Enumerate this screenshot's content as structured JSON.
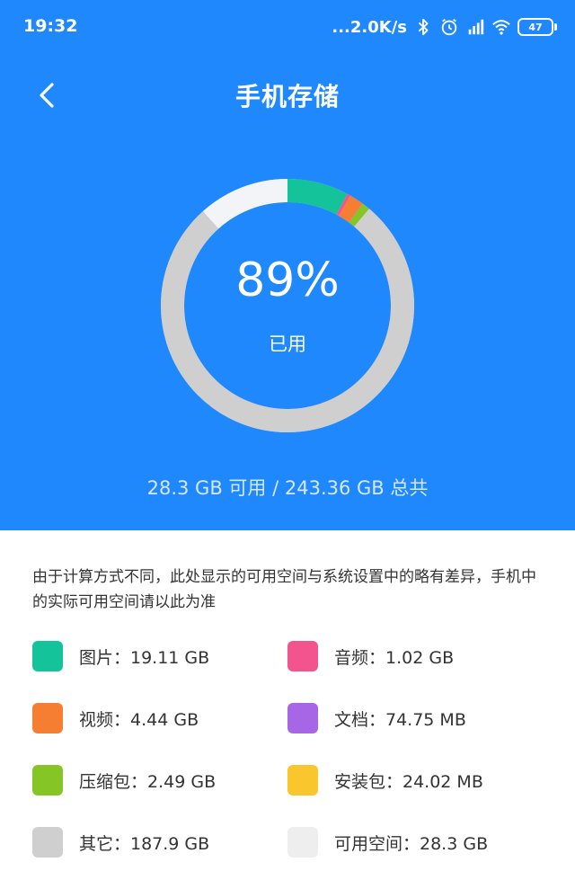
{
  "status_bar": {
    "time": "19:32",
    "net_speed": "...2.0K/s",
    "battery": "47",
    "icons": [
      "bluetooth-icon",
      "alarm-icon",
      "hd-signal-icon",
      "wifi-icon",
      "battery-icon"
    ]
  },
  "header": {
    "title": "手机存储",
    "back_icon": "chevron-left-icon"
  },
  "storage": {
    "percent": "89%",
    "used_label": "已用",
    "available": "28.3 GB 可用",
    "separator": " / ",
    "total": "243.36 GB 总共"
  },
  "note": "由于计算方式不同，此处显示的可用空间与系统设置中的略有差异，手机中的实际可用空间请以此为准",
  "categories": [
    {
      "label": "图片：19.11 GB",
      "color": "#14C39A",
      "gb": 19.11
    },
    {
      "label": "音频：1.02 GB",
      "color": "#F3548D",
      "gb": 1.02
    },
    {
      "label": "视频：4.44 GB",
      "color": "#F57E33",
      "gb": 4.44
    },
    {
      "label": "文档：74.75 MB",
      "color": "#A766E6",
      "gb": 0.075
    },
    {
      "label": "压缩包：2.49 GB",
      "color": "#85C525",
      "gb": 2.49
    },
    {
      "label": "安装包：24.02 MB",
      "color": "#FAC62D",
      "gb": 0.024
    },
    {
      "label": "其它：187.9 GB",
      "color": "#CFCFCF",
      "gb": 187.9
    },
    {
      "label": "可用空间：28.3 GB",
      "color": "#EEEEEE",
      "gb": 28.3
    }
  ],
  "colors": {
    "header_bg": "#1E88FC",
    "ring_track": "#D0D0D0",
    "ring_free": "#F2F4F7"
  }
}
